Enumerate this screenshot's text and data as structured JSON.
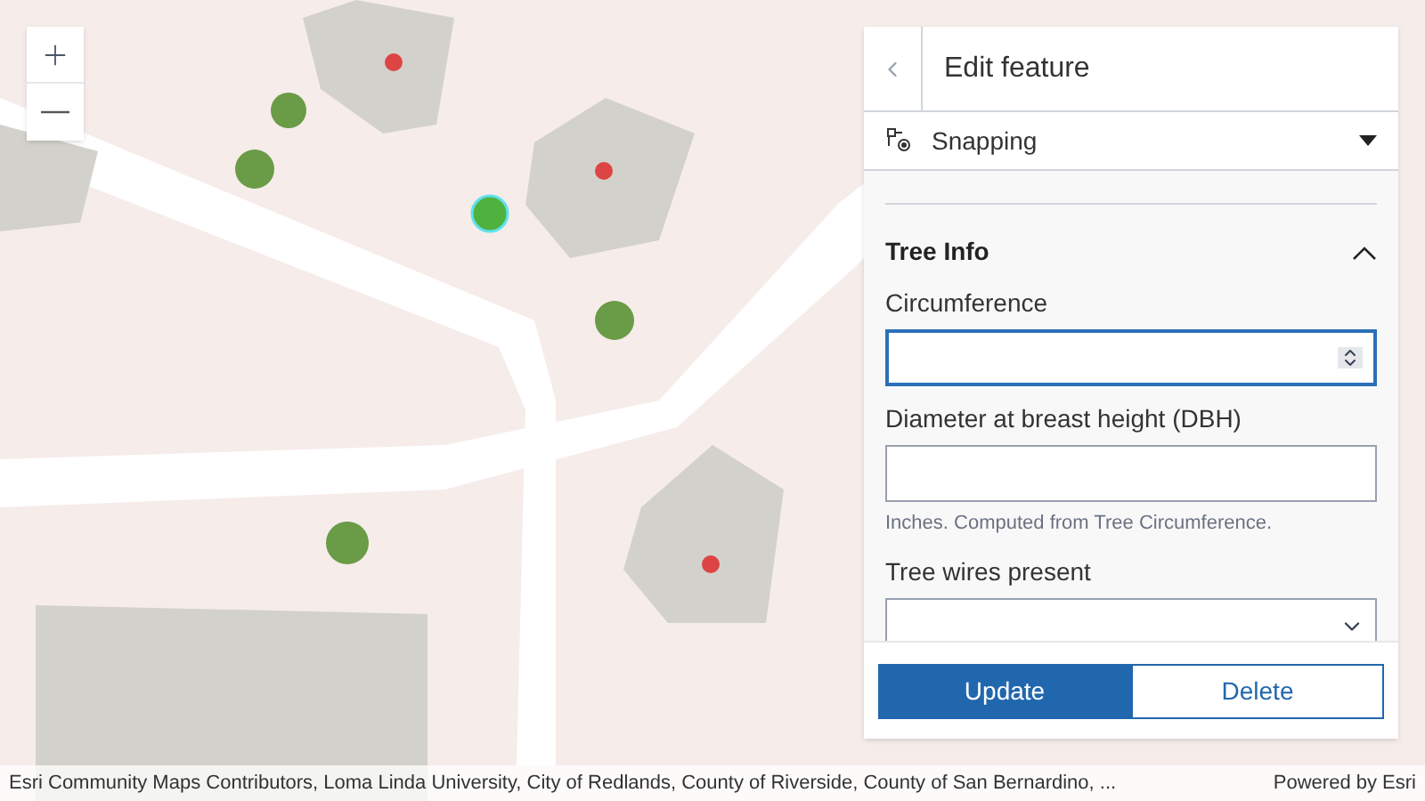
{
  "panel": {
    "title": "Edit feature",
    "snapping": {
      "label": "Snapping",
      "expanded": false
    },
    "section": {
      "title": "Tree Info",
      "expanded": true,
      "fields": [
        {
          "kind": "number",
          "label": "Circumference",
          "focused": true
        },
        {
          "kind": "text",
          "label": "Diameter at breast height (DBH)",
          "hint": "Inches. Computed from Tree Circumference.",
          "focused": false
        },
        {
          "kind": "select",
          "label": "Tree wires present",
          "focused": false
        }
      ]
    },
    "buttons": [
      {
        "kind": "primary",
        "label": "Update"
      },
      {
        "kind": "secondary",
        "label": "Delete"
      }
    ]
  },
  "attribution": {
    "text": "Esri Community Maps Contributors, Loma Linda University, City of Redlands, County of Riverside, County of San Bernardino, ...",
    "powered_by": "Powered by Esri"
  }
}
